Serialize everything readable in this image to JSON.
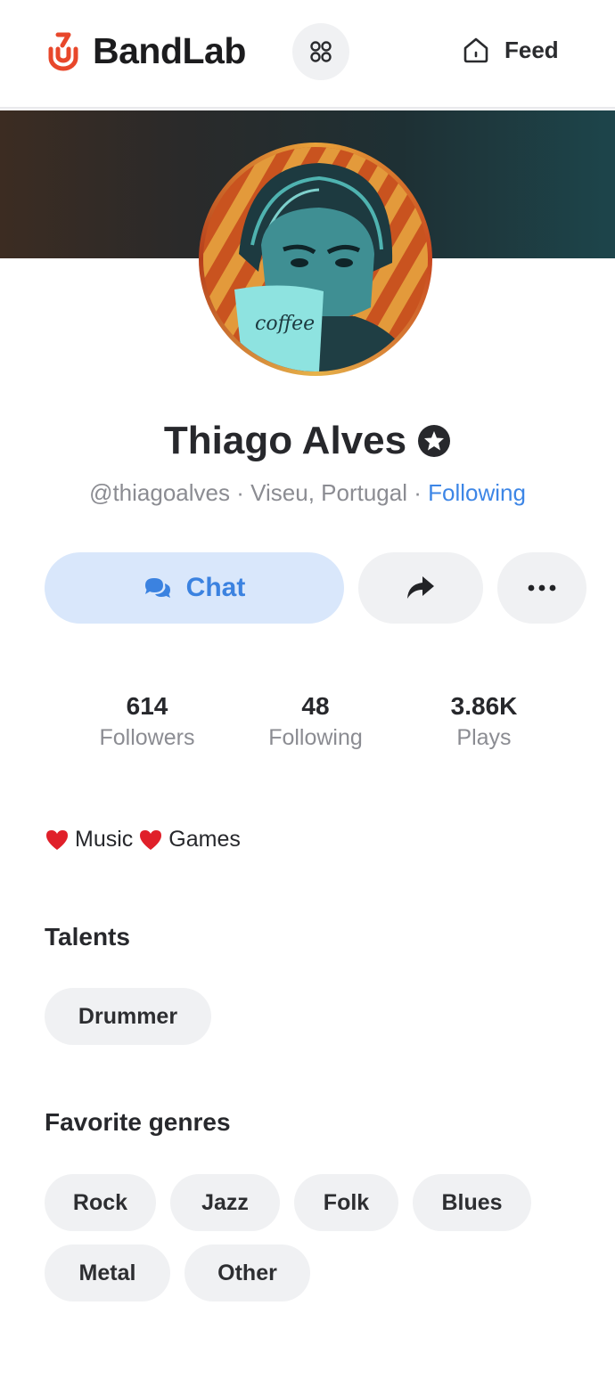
{
  "header": {
    "logo_text": "BandLab",
    "feed_label": "Feed"
  },
  "profile": {
    "name": "Thiago Alves",
    "handle": "@thiagoalves",
    "location": "Viseu, Portugal",
    "follow_status": "Following"
  },
  "actions": {
    "chat_label": "Chat"
  },
  "stats": [
    {
      "value": "614",
      "label": "Followers"
    },
    {
      "value": "48",
      "label": "Following"
    },
    {
      "value": "3.86K",
      "label": "Plays"
    }
  ],
  "bio": {
    "word1": "Music",
    "word2": "Games"
  },
  "talents": {
    "title": "Talents",
    "items": [
      "Drummer"
    ]
  },
  "genres": {
    "title": "Favorite genres",
    "items": [
      "Rock",
      "Jazz",
      "Folk",
      "Blues",
      "Metal",
      "Other"
    ]
  },
  "colors": {
    "brand": "#e8472b",
    "accent": "#3d86e6",
    "chip_bg": "#f0f1f3"
  },
  "icons": {
    "logo": "bandlab-logo-icon",
    "apps": "apps-grid-icon",
    "feed": "home-icon",
    "verified": "star-badge-icon",
    "chat": "chat-bubbles-icon",
    "share": "share-arrow-icon",
    "more": "more-dots-icon",
    "bio_emoji": "red-heart-icon"
  }
}
